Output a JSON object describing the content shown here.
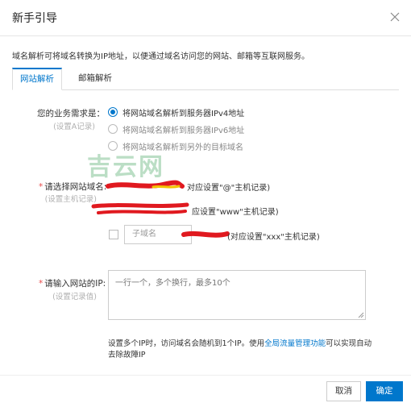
{
  "dialog": {
    "title": "新手引导",
    "close_icon": "close-icon"
  },
  "intro": "域名解析可将域名转换为IP地址，以便通过域名访问您的网站、邮箱等互联网服务。",
  "tabs": [
    {
      "label": "网站解析",
      "active": true
    },
    {
      "label": "邮箱解析",
      "active": false
    }
  ],
  "business": {
    "label": "您的业务需求是：",
    "sublabel": "(设置A记录)",
    "options": [
      {
        "label": "将网站域名解析到服务器IPv4地址",
        "checked": true
      },
      {
        "label": "将网站域名解析到服务器IPv6地址",
        "checked": false
      },
      {
        "label": "将网站域名解析到另外的目标域名",
        "checked": false
      }
    ]
  },
  "watermark": "吉云网",
  "domain_select": {
    "required_mark": "*",
    "label": "请选择网站域名:",
    "sublabel": "(设置主机记录)",
    "row1_text": "对应设置\"@\"主机记录)",
    "row2_text": "应设置\"www\"主机记录)",
    "subdomain_placeholder": "子域名",
    "row3_text": "(对应设置\"xxx\"主机记录)"
  },
  "ip_input": {
    "required_mark": "*",
    "label": "请输入网站的IP:",
    "sublabel": "(设置记录值)",
    "placeholder": "一行一个，多个换行，最多10个"
  },
  "hint": {
    "before": "设置多个IP时，访问域名会随机到1个IP。使用",
    "link": "全局流量管理功能",
    "after": "可以实现自动去除故障IP"
  },
  "footer": {
    "cancel": "取消",
    "confirm": "确定"
  },
  "colors": {
    "accent": "#0077cc",
    "required": "#e84a4a",
    "redaction": "#e0191f"
  }
}
